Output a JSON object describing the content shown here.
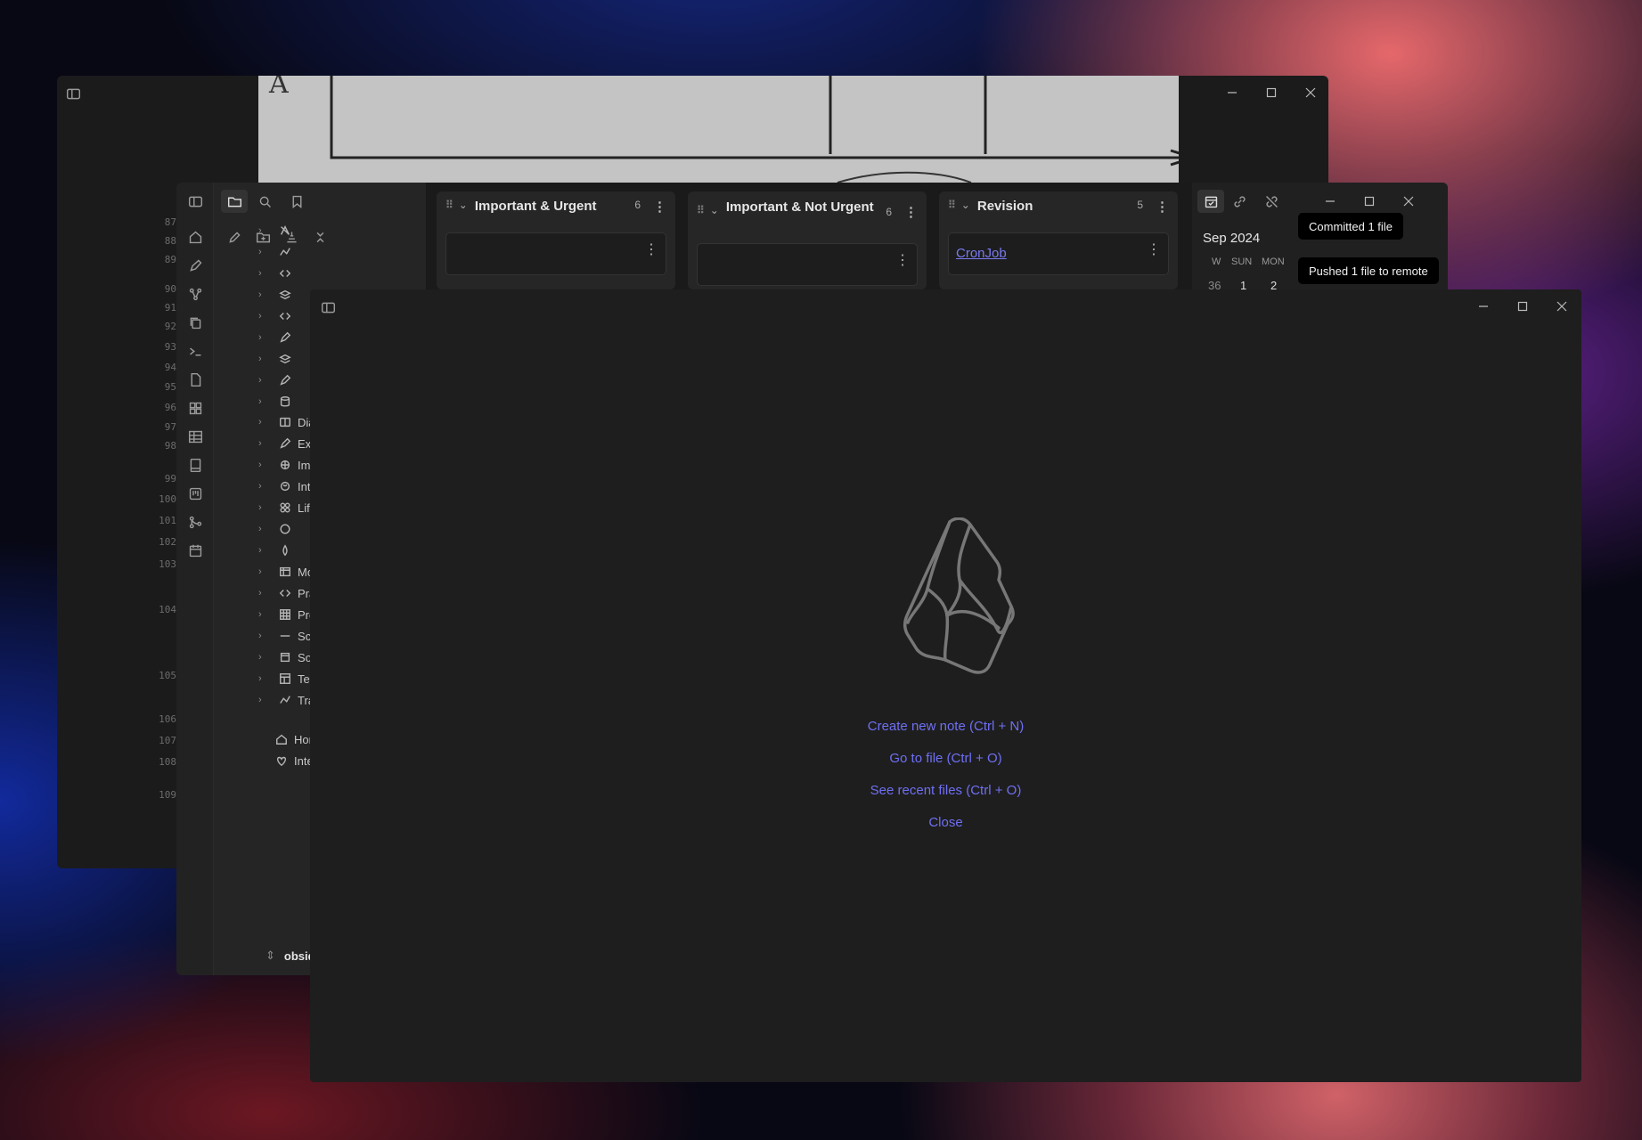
{
  "back_window": {
    "line_numbers": [
      "87",
      "88",
      "89",
      "90",
      "91",
      "92",
      "93",
      "94",
      "95",
      "96",
      "97",
      "98",
      "99",
      "100",
      "101",
      "102",
      "103",
      "104",
      "105",
      "106",
      "107",
      "108",
      "109"
    ],
    "canvas_text": "A"
  },
  "kanban": {
    "lanes": [
      {
        "title": "Important & Urgent",
        "count": "6"
      },
      {
        "title": "Important & Not Urgent",
        "count": "6"
      },
      {
        "title": "Revision",
        "count": "5",
        "card_link": "CronJob"
      }
    ]
  },
  "calendar": {
    "month": "Sep 2024",
    "headers": [
      "W",
      "SUN",
      "MON"
    ],
    "week": "36",
    "days": [
      "1",
      "2"
    ]
  },
  "notifications": [
    "Committed 1 file",
    "Pushed 1 file to remote"
  ],
  "explorer": {
    "folders": [
      "Diary",
      "Excalidra",
      "Images",
      "Introspe",
      "Life Know",
      "",
      "",
      "Movies",
      "Practice",
      "Problem",
      "Scripts",
      "Source C",
      "Template",
      "Tracking"
    ],
    "files": [
      "Home",
      "Interview"
    ],
    "vault_name": "obsidian-no"
  },
  "empty_state": {
    "actions": [
      "Create new note (Ctrl + N)",
      "Go to file (Ctrl + O)",
      "See recent files (Ctrl + O)",
      "Close"
    ]
  },
  "icons": {
    "sidebar_toggle": "sidebar-toggle-icon",
    "minimize": "minimize-icon",
    "maximize": "maximize-icon",
    "close": "close-icon",
    "logo": "obsidian-logo"
  },
  "colors": {
    "accent": "#6f6ff5",
    "background": "#1e1e1e"
  }
}
